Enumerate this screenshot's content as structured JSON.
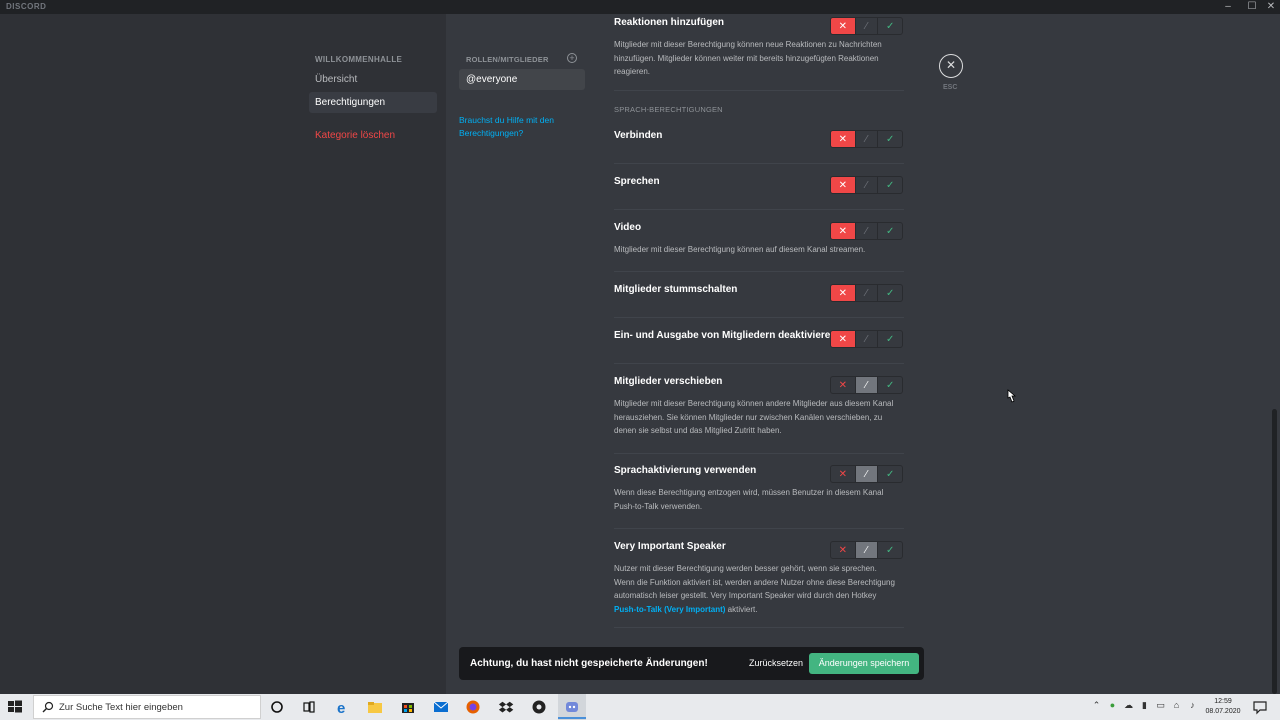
{
  "app": {
    "title": "DISCORD"
  },
  "sidebar": {
    "section_header": "WILLKOMMENHALLE",
    "items": [
      {
        "label": "Übersicht"
      },
      {
        "label": "Berechtigungen"
      },
      {
        "label": "Kategorie löschen"
      }
    ]
  },
  "roles": {
    "header": "ROLLEN/MITGLIEDER",
    "selected": "@everyone",
    "help_link": "Brauchst du Hilfe mit den Berechtigungen?"
  },
  "permissions": {
    "voice_section_header": "SPRACH-BERECHTIGUNGEN",
    "items": [
      {
        "title": "Reaktionen hinzufügen",
        "description": "Mitglieder mit dieser Berechtigung können neue Reaktionen zu Nachrichten hinzufügen. Mitglieder können weiter mit bereits hinzugefügten Reaktionen reagieren.",
        "state": "deny"
      },
      {
        "title": "Verbinden",
        "description": "",
        "state": "deny"
      },
      {
        "title": "Sprechen",
        "description": "",
        "state": "deny"
      },
      {
        "title": "Video",
        "description": "Mitglieder mit dieser Berechtigung können auf diesem Kanal streamen.",
        "state": "deny"
      },
      {
        "title": "Mitglieder stummschalten",
        "description": "",
        "state": "deny"
      },
      {
        "title": "Ein- und Ausgabe von Mitgliedern deaktivieren",
        "description": "",
        "state": "deny"
      },
      {
        "title": "Mitglieder verschieben",
        "description": "Mitglieder mit dieser Berechtigung können andere Mitglieder aus diesem Kanal herausziehen. Sie können Mitglieder nur zwischen Kanälen verschieben, zu denen sie selbst und das Mitglied Zutritt haben.",
        "state": "neutral"
      },
      {
        "title": "Sprachaktivierung verwenden",
        "description": "Wenn diese Berechtigung entzogen wird, müssen Benutzer in diesem Kanal Push-to-Talk verwenden.",
        "state": "neutral"
      },
      {
        "title": "Very Important Speaker",
        "description_pre": "Nutzer mit dieser Berechtigung werden besser gehört, wenn sie sprechen. Wenn die Funktion aktiviert ist, werden andere Nutzer ohne diese Berechtigung automatisch leiser gestellt. Very Important Speaker wird durch den Hotkey ",
        "description_link": "Push-to-Talk (Very Important)",
        "description_post": " aktiviert.",
        "state": "neutral"
      }
    ]
  },
  "close": {
    "label": "ESC"
  },
  "notice": {
    "text": "Achtung, du hast nicht gespeicherte Änderungen!",
    "reset_label": "Zurücksetzen",
    "save_label": "Änderungen speichern"
  },
  "taskbar": {
    "search_placeholder": "Zur Suche Text hier eingeben",
    "time": "12:59",
    "date": "08.07.2020"
  },
  "colors": {
    "deny": "#f04747",
    "allow": "#43b581",
    "link": "#00b0f4",
    "save_button": "#43b581"
  },
  "icons": [
    "close-icon",
    "check-icon",
    "slash-icon",
    "add-circle-icon",
    "windows-start-icon",
    "search-icon",
    "task-view-icon",
    "edge-icon",
    "explorer-icon",
    "store-icon",
    "mail-icon",
    "firefox-icon",
    "dropbox-icon",
    "obs-icon",
    "discord-icon",
    "notification-icon"
  ]
}
